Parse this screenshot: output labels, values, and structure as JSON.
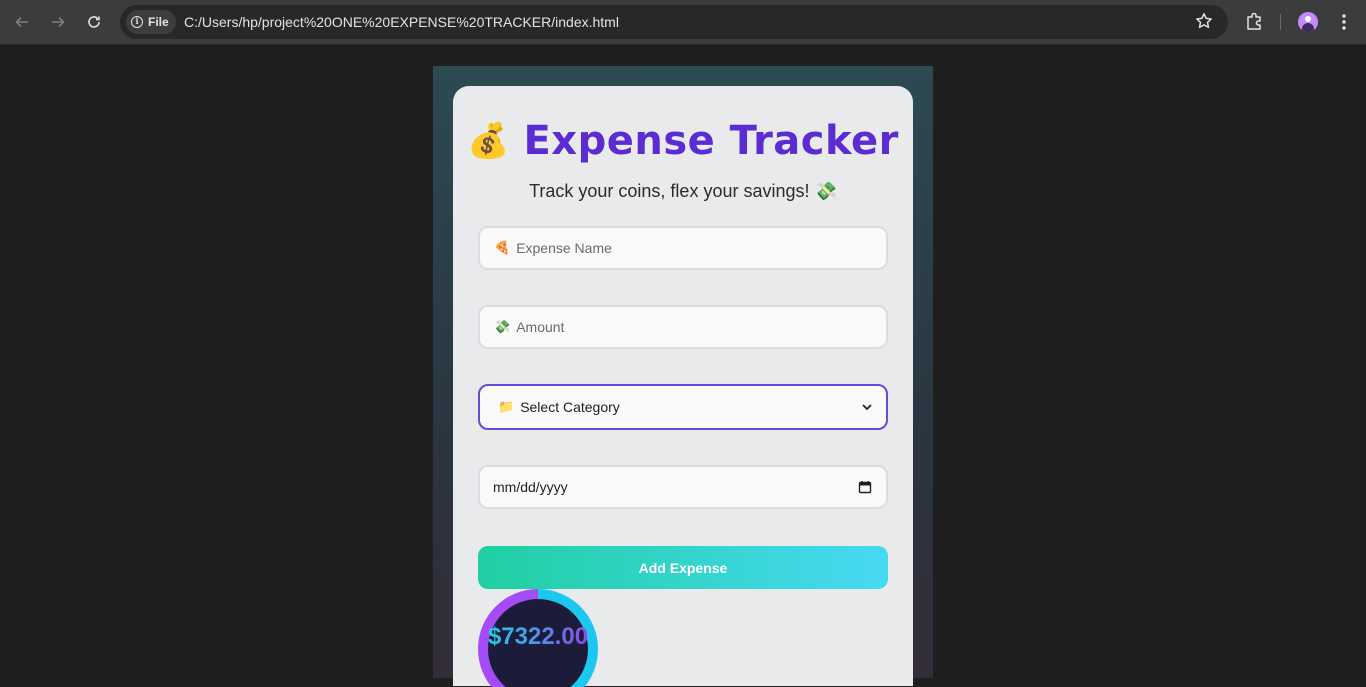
{
  "browser": {
    "site_chip_label": "File",
    "url": "C:/Users/hp/project%20ONE%20EXPENSE%20TRACKER/index.html",
    "icons": [
      "back-arrow-icon",
      "forward-arrow-icon",
      "reload-icon",
      "info-icon",
      "star-icon",
      "extensions-icon",
      "profile-avatar",
      "more-menu-icon"
    ]
  },
  "app": {
    "title_emoji": "💰",
    "title": "Expense Tracker",
    "subtitle": "Track your coins, flex your savings! 💸",
    "form": {
      "name_emoji": "🍕",
      "name_placeholder": "Expense Name",
      "amount_emoji": "💸",
      "amount_placeholder": "Amount",
      "category_emoji": "📁",
      "category_selected": "Select Category",
      "date_placeholder": "mm/dd/yyyy",
      "submit_label": "Add Expense"
    },
    "total": "$7322.00"
  },
  "colors": {
    "title": "#5b2cd1",
    "button_start": "#20cfa2",
    "button_end": "#47d9f3",
    "ring_cyan": "#1cc7f0",
    "ring_purple": "#a34cf7",
    "select_focus_border": "#6a4bd8"
  }
}
